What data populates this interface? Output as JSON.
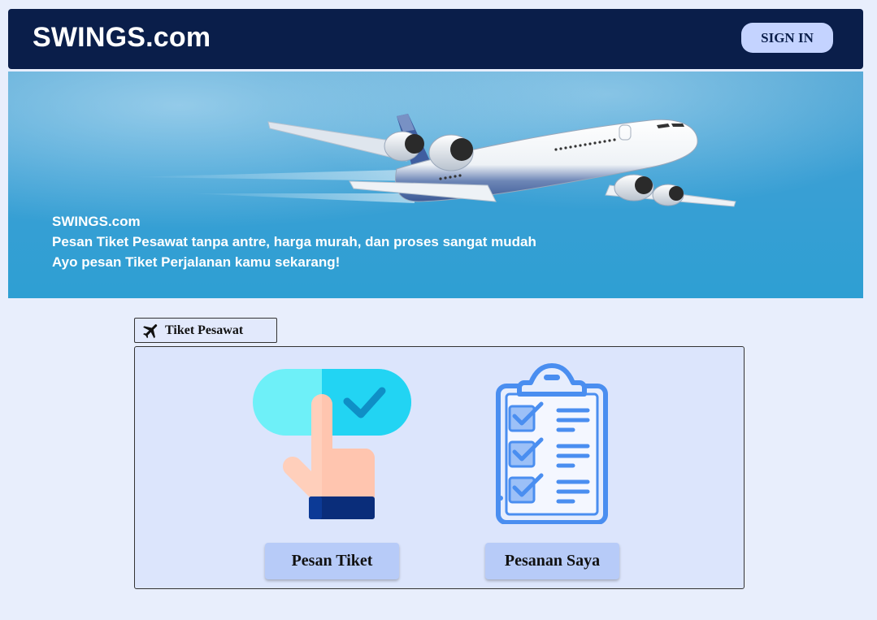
{
  "navbar": {
    "brand": "SWINGS.com",
    "signin_label": "SIGN IN"
  },
  "hero": {
    "line1": "SWINGS.com",
    "line2": "Pesan Tiket Pesawat tanpa antre, harga murah, dan proses sangat mudah",
    "line3": "Ayo pesan Tiket Perjalanan kamu sekarang!",
    "image": "airplane-photo"
  },
  "section": {
    "tab_label": "Tiket Pesawat",
    "tab_icon": "airplane-icon",
    "actions": [
      {
        "label": "Pesan Tiket",
        "icon": "tap-checkmark-icon"
      },
      {
        "label": "Pesanan Saya",
        "icon": "clipboard-checklist-icon"
      }
    ]
  },
  "colors": {
    "navbar_bg": "#0a1e4a",
    "page_bg": "#e8eefc",
    "button_bg": "#b7cbf8",
    "signin_bg": "#c4d3ff"
  }
}
